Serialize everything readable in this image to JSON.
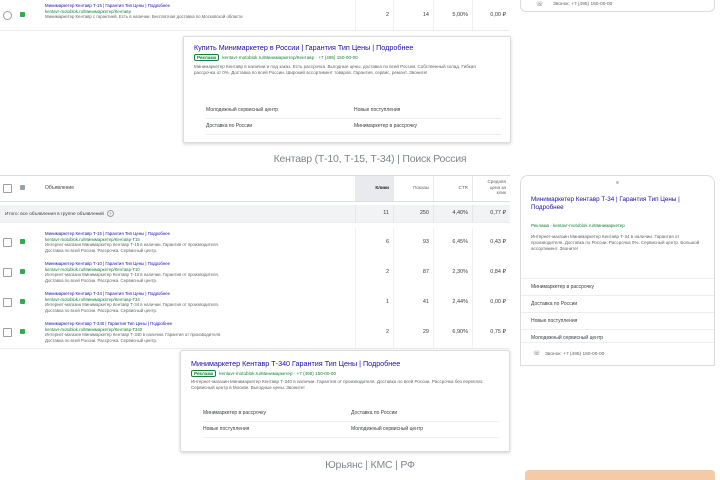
{
  "colors": {
    "title_link": "#1a0dab",
    "display_url": "#188038",
    "status_active": "#34a853",
    "bottom_block": "#f5cba7"
  },
  "top_group": {
    "row": {
      "title": "Минимаркетер Кентавр Т-15 | Гарантия Тип Цены | Подробнее",
      "url": "kentavr-motoblok.ru/Минимаркетер/Кентавр",
      "desc": "Минимаркетер Кентавр с гарантией. Есть в наличии. Бесплатная доставка по Московской области",
      "clicks": "2",
      "impressions": "14",
      "ctr": "5,00%",
      "cpc": "0,00 ₽"
    },
    "mobile_phone": "Звонок: +7 (495) 150-00-00",
    "preview": {
      "title": "Купить Минимаркетер в России | Гарантия Тип Цены | Подробнее",
      "badge": "Реклама",
      "url": "kentavr-motoblok.ru/Минимаркетер/Кентавр · +7 (495) 150-00-00",
      "desc": "Минимаркетер Кентавр в наличии и под заказ. Есть рассрочка. Выгодные цены, доставка по всей России. Собственный склад. Гибкая рассрочка от 0%. Доставка по всей России. Широкий ассортимент товаров. Гарантия, сервис, ремонт. Звоните!",
      "sitelinks": [
        "Молодежный сервисный центр",
        "Новые поступления",
        "Доставка по России",
        "Минимаркетер в рассрочку"
      ]
    }
  },
  "group2": {
    "heading": "Кентавр (Т-10, Т-15, Т-34) | Поиск Россия",
    "table": {
      "headers": {
        "ad": "Объявление",
        "clicks": "Клики",
        "impressions": "Показы",
        "ctr": "CTR",
        "cpc": "Средняя цена за клик"
      },
      "summary": {
        "label": "Итого: все объявления в группе объявлений",
        "info": "?",
        "clicks": "11",
        "impressions": "250",
        "ctr": "4,40%",
        "cpc": "0,77 ₽"
      },
      "rows": [
        {
          "title": "Минимаркетер Кентавр Т-15 | Гарантия Тип Цены | Подробнее",
          "url": "kentavr-motoblok.ru/Минимаркетер/Кентавр-Т15",
          "desc1": "Интернет-магазин Минимаркетер Кентавр Т-15 в наличии. Гарантия от производителя.",
          "desc2": "Доставка по всей России. Рассрочка. Сервисный центр.",
          "clicks": "6",
          "impressions": "93",
          "ctr": "6,45%",
          "cpc": "0,43 ₽"
        },
        {
          "title": "Минимаркетер Кентавр Т-10 | Гарантия Тип Цены | Подробнее",
          "url": "kentavr-motoblok.ru/Минимаркетер/Кентавр-Т10",
          "desc1": "Интернет-магазин Минимаркетер Кентавр Т-10 в наличии. Гарантия от производителя.",
          "desc2": "Доставка по всей России. Рассрочка. Сервисный центр.",
          "clicks": "2",
          "impressions": "87",
          "ctr": "2,30%",
          "cpc": "0,84 ₽"
        },
        {
          "title": "Минимаркетер Кентавр Т-34 | Гарантия Тип Цены | Подробнее",
          "url": "kentavr-motoblok.ru/Минимаркетер/Кентавр-Т34",
          "desc1": "Интернет-магазин Минимаркетер Кентавр Т-34 в наличии. Гарантия от производителя.",
          "desc2": "Доставка по всей России. Рассрочка. Сервисный центр.",
          "clicks": "1",
          "impressions": "41",
          "ctr": "2,44%",
          "cpc": "0,00 ₽"
        },
        {
          "title": "Минимаркетер Кентавр Т-340 | Гарантия Тип Цены | Подробнее",
          "url": "kentavr-motoblok.ru/Минимаркетер/Кентавр-Т340",
          "desc1": "Интернет-магазин Минимаркетер Кентавр Т-340 в наличии. Гарантия от производителя.",
          "desc2": "Доставка по всей России. Рассрочка. Сервисный центр.",
          "clicks": "2",
          "impressions": "29",
          "ctr": "6,90%",
          "cpc": "0,75 ₽"
        }
      ]
    },
    "mobile_preview": {
      "title": "Минимаркетер Кентавр Т-34 | Гарантия Тип Цены | Подробнее",
      "url": "Реклама · kentavr-motoblok.ru/Минимаркетер",
      "desc": "Интернет-магазин Минимаркетер Кентавр Т-34 в наличии. Гарантия от производителя. Доставка по России. Рассрочка 0%. Сервисный центр. Большой ассортимент. Звоните!",
      "sitelinks": [
        "Минимаркетер в рассрочку",
        "Доставка по России",
        "Новые поступления",
        "Молодежный сервисный центр"
      ],
      "phone": "Звонок: +7 (495) 150-00-00"
    },
    "preview": {
      "title": "Минимаркетер Кентавр Т-340 Гарантия Тип Цены | Подробнее",
      "badge": "Реклама",
      "url": "kentavr-motoblok.ru/Минимаркетер · +7 (495) 150-00-00",
      "desc": "Интернет-магазин Минимаркетер Кентавр Т-340 в наличии. Гарантия от производителя. Доставка по всей России. Рассрочка без переплат. Сервисный центр в Москве. Выгодные цены. Звоните!",
      "sitelinks": [
        "Минимаркетер в рассрочку",
        "Доставка по России",
        "Новые поступления",
        "Молодежный сервисный центр"
      ]
    }
  },
  "group3": {
    "heading": "Юрьянс | КМС | РФ"
  },
  "icons": {
    "phone": "☏"
  }
}
